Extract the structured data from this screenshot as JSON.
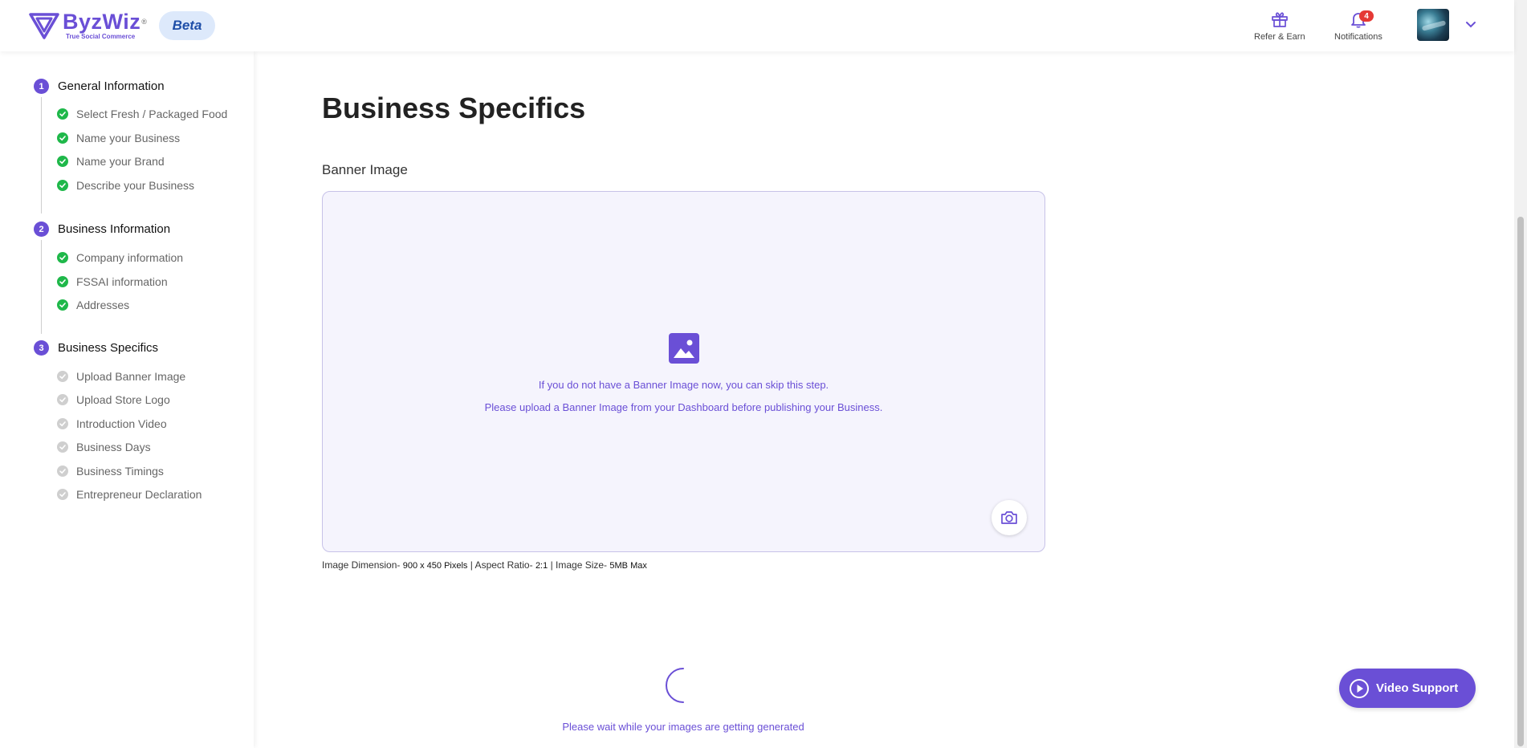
{
  "header": {
    "logo_name": "ByzWiz",
    "logo_registered": "®",
    "logo_tagline": "True Social Commerce",
    "beta_label": "Beta",
    "refer_label": "Refer & Earn",
    "notifications_label": "Notifications",
    "notifications_count": "4",
    "accent_color": "#6a4fd6"
  },
  "sidebar": {
    "sections": [
      {
        "number": "1",
        "title": "General Information",
        "steps": [
          {
            "label": "Select Fresh / Packaged Food",
            "status": "done"
          },
          {
            "label": "Name your Business",
            "status": "done"
          },
          {
            "label": "Name your Brand",
            "status": "done"
          },
          {
            "label": "Describe your Business",
            "status": "done"
          }
        ]
      },
      {
        "number": "2",
        "title": "Business Information",
        "steps": [
          {
            "label": "Company information",
            "status": "done"
          },
          {
            "label": "FSSAI information",
            "status": "done"
          },
          {
            "label": "Addresses",
            "status": "done"
          }
        ]
      },
      {
        "number": "3",
        "title": "Business Specifics",
        "steps": [
          {
            "label": "Upload Banner Image",
            "status": "pending"
          },
          {
            "label": "Upload Store Logo",
            "status": "pending"
          },
          {
            "label": "Introduction Video",
            "status": "pending"
          },
          {
            "label": "Business Days",
            "status": "pending"
          },
          {
            "label": "Business Timings",
            "status": "pending"
          },
          {
            "label": "Entrepreneur Declaration",
            "status": "pending"
          }
        ]
      }
    ]
  },
  "main": {
    "page_title": "Business Specifics",
    "banner_label": "Banner Image",
    "dropzone_line1": "If you do not have a Banner Image now, you can skip this step.",
    "dropzone_line2": "Please upload a Banner Image from your Dashboard before publishing your Business.",
    "meta_prefix1": "Image Dimension- ",
    "meta_value1": "900 x 450 Pixels",
    "meta_prefix2": " | Aspect Ratio- ",
    "meta_value2": "2:1",
    "meta_prefix3": " | Image Size- ",
    "meta_value3": "5MB Max",
    "wait_text": "Please wait while your images are getting generated",
    "video_support_label": "Video Support"
  },
  "icons": {
    "refer": "gift-icon",
    "notifications": "bell-icon",
    "chevron": "chevron-down-icon",
    "upload": "image-icon",
    "camera": "camera-icon",
    "video": "play-icon"
  }
}
